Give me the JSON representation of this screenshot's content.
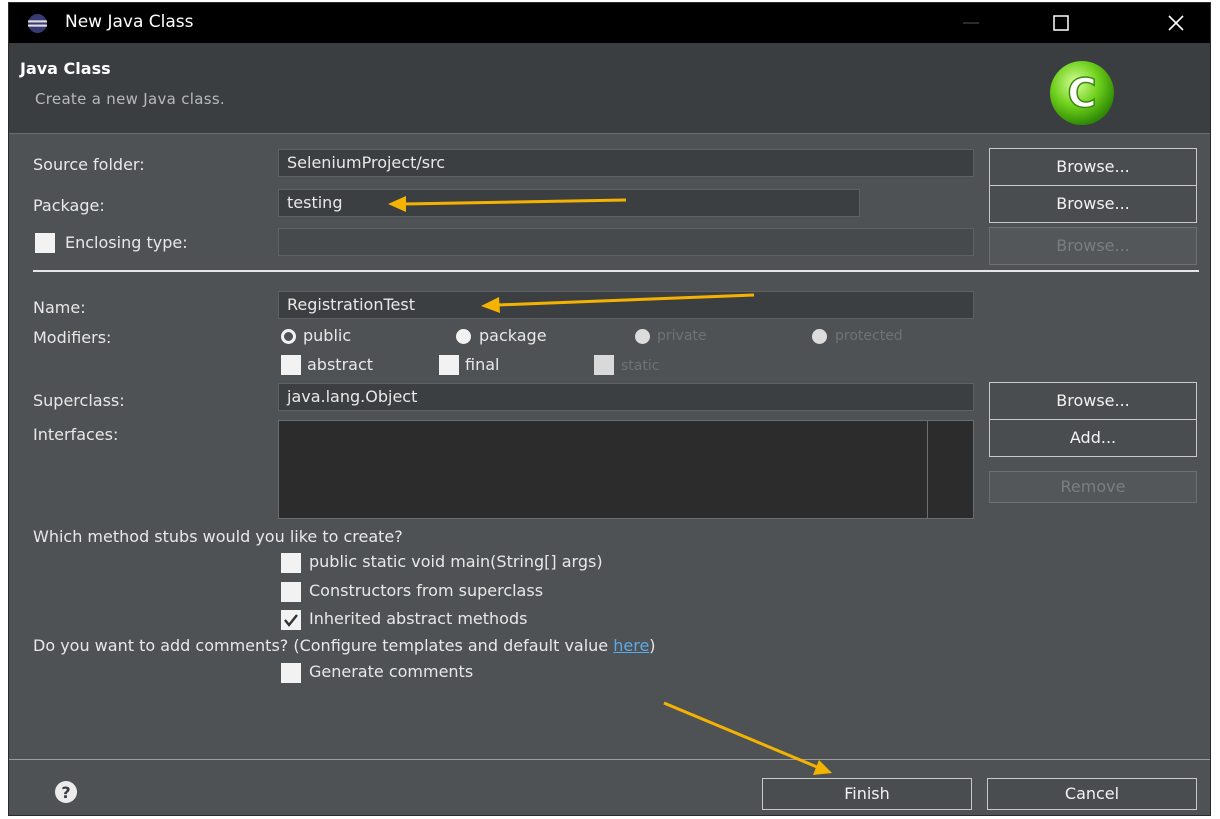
{
  "window": {
    "title": "New Java Class",
    "icon": "eclipse-icon"
  },
  "banner": {
    "title": "Java Class",
    "description": "Create a new Java class.",
    "logo_icon": "new-class-c-icon"
  },
  "form": {
    "source_folder": {
      "label": "Source folder:",
      "value": "SeleniumProject/src",
      "browse": "Browse..."
    },
    "package": {
      "label": "Package:",
      "value": "testing",
      "browse": "Browse..."
    },
    "enclosing_type": {
      "label": "Enclosing type:",
      "value": "",
      "checked": false,
      "browse": "Browse..."
    },
    "name": {
      "label": "Name:",
      "value": "RegistrationTest"
    },
    "modifiers": {
      "label": "Modifiers:",
      "access": [
        {
          "label": "public",
          "selected": true
        },
        {
          "label": "package",
          "selected": false
        },
        {
          "label": "private",
          "selected": false
        },
        {
          "label": "protected",
          "selected": false
        }
      ],
      "flags": [
        {
          "label": "abstract",
          "checked": false
        },
        {
          "label": "final",
          "checked": false
        },
        {
          "label": "static",
          "checked": false
        }
      ]
    },
    "superclass": {
      "label": "Superclass:",
      "value": "java.lang.Object",
      "browse": "Browse..."
    },
    "interfaces": {
      "label": "Interfaces:",
      "add": "Add...",
      "remove": "Remove"
    }
  },
  "stubs": {
    "question": "Which method stubs would you like to create?",
    "options": [
      {
        "label": "public static void main(String[] args)",
        "checked": false
      },
      {
        "label": "Constructors from superclass",
        "checked": false
      },
      {
        "label": "Inherited abstract methods",
        "checked": true
      }
    ]
  },
  "comments": {
    "question": "Do you want to add comments? (Configure templates and default value ",
    "link": "here",
    "question_end": ")",
    "option": {
      "label": "Generate comments",
      "checked": false
    }
  },
  "footer": {
    "help_icon": "help-icon",
    "finish": "Finish",
    "cancel": "Cancel"
  },
  "colors": {
    "dialog_bg": "#4f5254",
    "field_bg": "#3c3f41",
    "annotation_arrow": "#f5b301",
    "link": "#5ca9e8"
  }
}
